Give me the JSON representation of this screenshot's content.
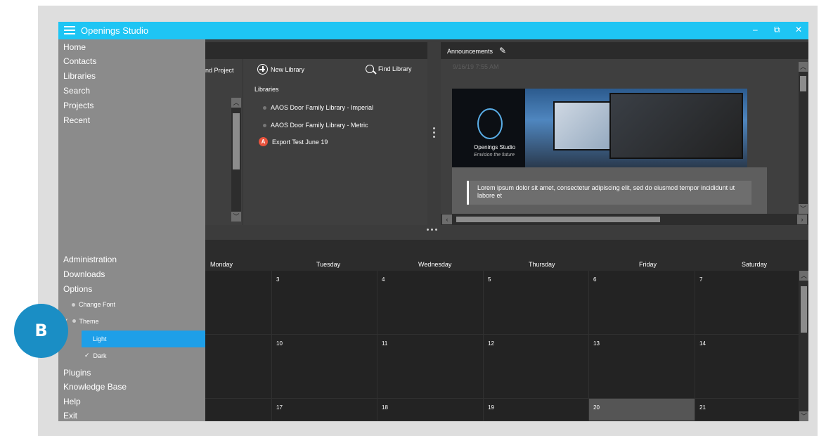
{
  "window": {
    "title": "Openings Studio",
    "minimize": "–",
    "restore": "⧉",
    "close": "✕"
  },
  "nav": {
    "top_items": [
      "Home",
      "Contacts",
      "Libraries",
      "Search",
      "Projects",
      "Recent"
    ],
    "bottom_items": [
      "Administration",
      "Downloads",
      "Options"
    ],
    "options_sub": {
      "change_font": "Change Font",
      "theme": "Theme",
      "theme_check": "✓",
      "light": "Light",
      "dark": "Dark",
      "dark_check": "✓"
    },
    "tail_items": [
      "Plugins",
      "Knowledge Base",
      "Help",
      "Exit"
    ]
  },
  "projects": {
    "header_partial": "nd Project"
  },
  "libraries": {
    "new_library": "New Library",
    "find_library": "Find Library",
    "section_label": "Libraries",
    "items": [
      {
        "label": "AAOS Door Family Library - Imperial"
      },
      {
        "label": "AAOS Door Family Library - Metric"
      },
      {
        "label": "Export Test June 19"
      }
    ]
  },
  "announcements": {
    "title": "Announcements",
    "date": "9/16/19 7:55 AM",
    "banner_brand": "Openings Studio",
    "banner_tagline": "Envision the future",
    "text": "Lorem ipsum dolor sit amet, consectetur adipiscing elit, sed do eiusmod tempor incididunt ut labore et"
  },
  "calendar": {
    "days": [
      "Monday",
      "Tuesday",
      "Wednesday",
      "Thursday",
      "Friday",
      "Saturday"
    ],
    "weeks": [
      [
        "",
        "3",
        "4",
        "5",
        "6",
        "7"
      ],
      [
        "",
        "10",
        "11",
        "12",
        "13",
        "14"
      ],
      [
        "",
        "17",
        "18",
        "19",
        "20",
        "21"
      ]
    ],
    "highlighted": "20"
  },
  "callout": {
    "letter": "B"
  },
  "colors": {
    "titlebar": "#1ec5f4",
    "selected": "#1e9fe8",
    "badge": "#1a8ec5"
  }
}
